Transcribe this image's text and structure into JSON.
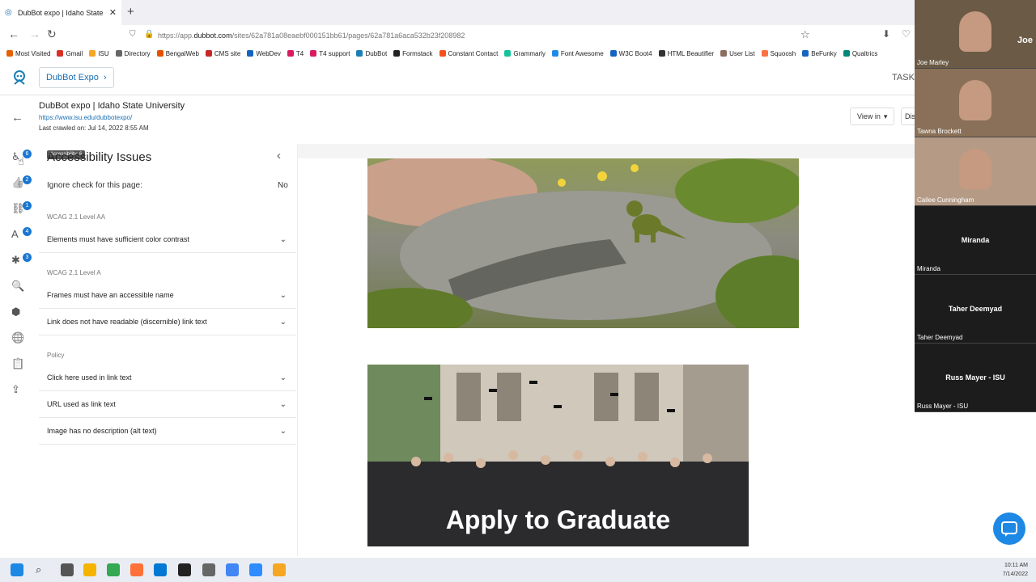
{
  "browser": {
    "tab_title": "DubBot expo | Idaho State Univ",
    "url_prefix": "https://app.",
    "url_domain": "dubbot.com",
    "url_path": "/sites/62a781a08eaebf000151bb61/pages/62a781a6aca532b23f208982",
    "bookmarks": [
      "Most Visited",
      "Gmail",
      "ISU",
      "Directory",
      "BengalWeb",
      "CMS site",
      "WebDev",
      "T4",
      "T4 support",
      "DubBot",
      "Formstack",
      "Constant Contact",
      "Grammarly",
      "Font Awesome",
      "W3C Boot4",
      "HTML Beautifier",
      "User List",
      "Squoosh",
      "BeFunky",
      "Qualtrics"
    ],
    "bookmark_colors": [
      "#e66000",
      "#d93025",
      "#f5a623",
      "#666666",
      "#e65100",
      "#c62828",
      "#1565c0",
      "#d81b60",
      "#d81b60",
      "#1a7fb5",
      "#222222",
      "#f4511e",
      "#15c39a",
      "#228ae6",
      "#1565c0",
      "#333333",
      "#8d6e63",
      "#ff7043",
      "#1565c0",
      "#00897b"
    ]
  },
  "app": {
    "site_button": "DubBot Expo",
    "tasks_label": "TASKS",
    "page_title": "DubBot expo | Idaho State University",
    "page_url": "https://www.isu.edu/dubbotexpo/",
    "last_crawled": "Last crawled on: Jul 14, 2022 8:55 AM",
    "view_in": "View in",
    "dis_label": "Dis"
  },
  "rail": {
    "tooltip": "Accessibility: 6",
    "items": [
      {
        "icon": "accessibility-icon",
        "glyph": "♿",
        "badge": "6"
      },
      {
        "icon": "thumbs-up-icon",
        "glyph": "👍",
        "badge": "2"
      },
      {
        "icon": "link-icon",
        "glyph": "⛓",
        "badge": "1"
      },
      {
        "icon": "spelling-icon",
        "glyph": "A",
        "badge": "4"
      },
      {
        "icon": "puzzle-icon",
        "glyph": "✱",
        "badge": "3"
      },
      {
        "icon": "search-doc-icon",
        "glyph": "🔍",
        "badge": ""
      },
      {
        "icon": "cube-icon",
        "glyph": "⬢",
        "badge": ""
      },
      {
        "icon": "globe-icon",
        "glyph": "🌐",
        "badge": ""
      },
      {
        "icon": "clipboard-icon",
        "glyph": "📋",
        "badge": ""
      },
      {
        "icon": "share-icon",
        "glyph": "⇪",
        "badge": ""
      }
    ]
  },
  "panel": {
    "title": "Accessibility Issues",
    "ignore_label": "Ignore check for this page:",
    "ignore_value": "No",
    "groups": [
      {
        "label": "WCAG 2.1 Level AA",
        "issues": [
          "Elements must have sufficient color contrast"
        ]
      },
      {
        "label": "WCAG 2.1 Level A",
        "issues": [
          "Frames must have an accessible name",
          "Link does not have readable (discernible) link text"
        ]
      },
      {
        "label": "Policy",
        "issues": [
          "Click here used in link text",
          "URL used as link text",
          "Image has no description (alt text)"
        ]
      }
    ]
  },
  "content": {
    "graduate_caption": "Apply to Graduate"
  },
  "participants": [
    {
      "name": "Joe Marley",
      "tag": "Joe",
      "video": true,
      "bg": "#6b5a45"
    },
    {
      "name": "Tawna Brockett",
      "tag": "",
      "video": true,
      "bg": "#8a7058"
    },
    {
      "name": "Cailee Cunningham",
      "tag": "",
      "video": true,
      "bg": "#b59b85"
    },
    {
      "name": "Miranda",
      "tag": "Miranda",
      "video": false,
      "bg": "#1c1c1c"
    },
    {
      "name": "Taher Deemyad",
      "tag": "Taher Deemyad",
      "video": false,
      "bg": "#1c1c1c"
    },
    {
      "name": "Russ Mayer - ISU",
      "tag": "Russ Mayer - ISU",
      "video": false,
      "bg": "#1c1c1c"
    }
  ],
  "taskbar": {
    "time": "10:11 AM",
    "date": "7/14/2022"
  }
}
